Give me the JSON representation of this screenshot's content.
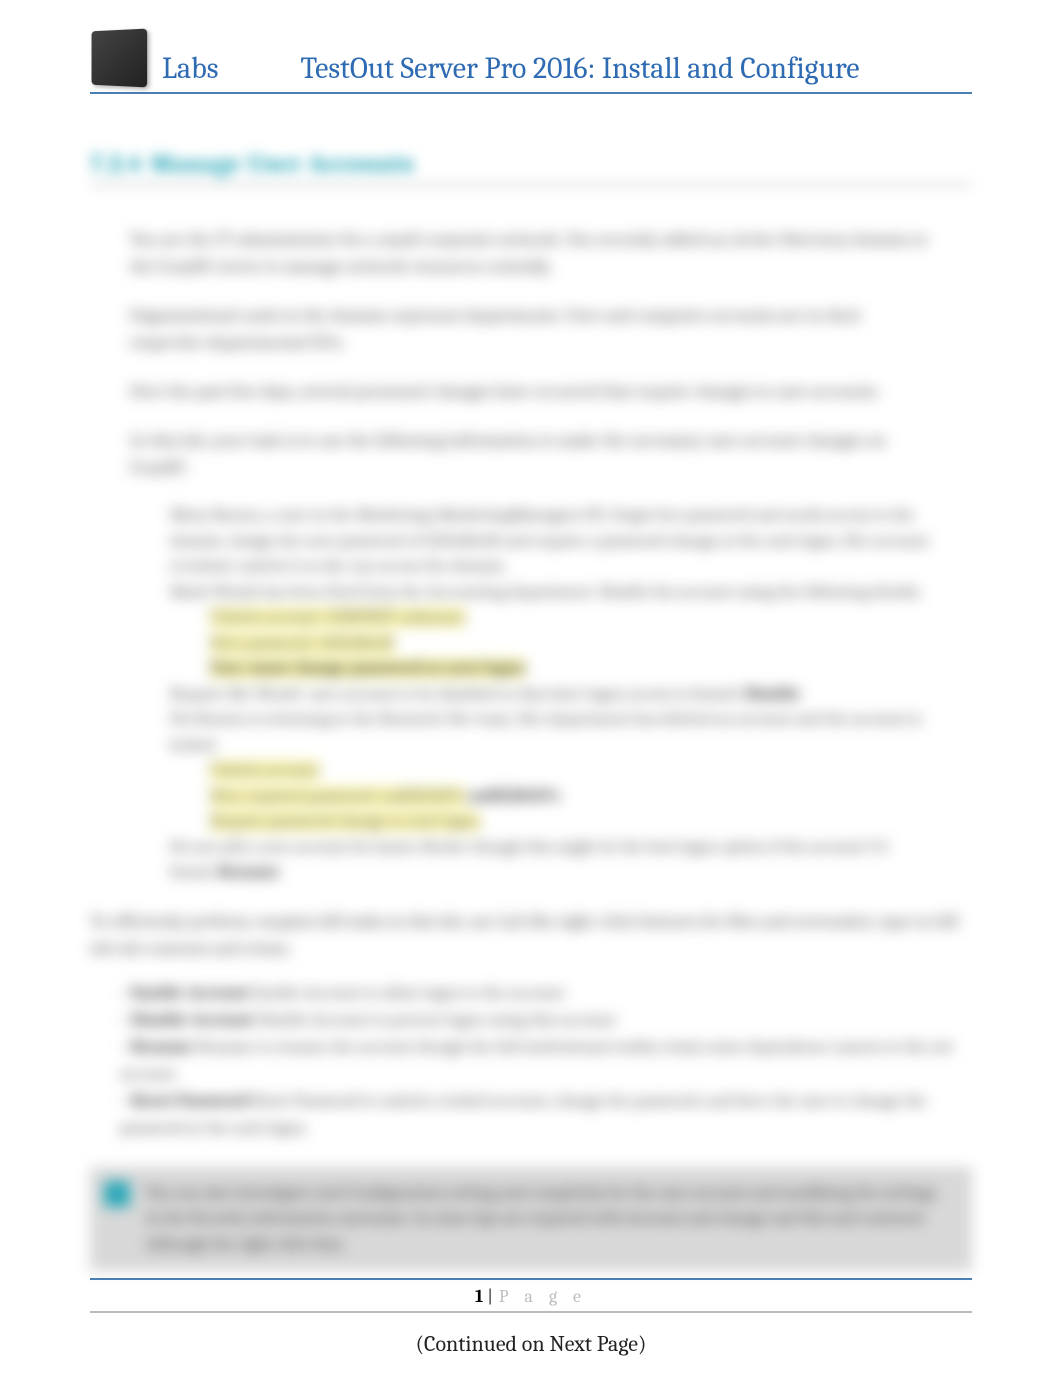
{
  "header": {
    "labs": "Labs",
    "title": "TestOut Server Pro 2016: Install and Configure"
  },
  "section": {
    "number": "7.2.4",
    "title": "Manage User Accounts"
  },
  "paragraphs": {
    "p1": "You are the IT administrator for a small corporate network. You recently added an Active Directory domain to the CorpDC server to manage network resources centrally.",
    "p2": "Organizational units in the domain represent departments. User and computer accounts are in their respective departmental OUs.",
    "p3": "Over the past few days, several personnel changes have occurred that require changes to user accounts.",
    "p4": "In this lab, your task is to use the following information to make the necessary user account changes on CorpDC:"
  },
  "list": {
    "li1a": "Mary Barnes, a user in the Marketing\\MarketingManagers OU, forgot her password and needs access to the domain.",
    "li1b": "Assign the new password of 1234ABcd$ and require a password change at the next logon. Her account is locked; unlock it so she can access the domain.",
    "li2": "Mark Woods has been fired from the Accounting department. Disable his account using the following details.",
    "li3a": "Unlock account: CORPNET\\mbarnes",
    "li3b": "New password: 1234ABcd$",
    "li3c": "User must change password at next logon",
    "li4": "Require Mr. Woods' user account to be disabled so that later logon access is denied.",
    "li5": "Pat Benton is returning to the Research-Dev team. Her department has deleted an account and the account is locked.",
    "li6a": "Unlock account",
    "li6b": "New required password: asdf1234$%",
    "li6c": "Require password change at next logon",
    "li7": "Do not add a new account for Janice Becker though this might be the best logon option if the account I'd found."
  },
  "paragraphs2": {
    "p5": "To efficiently perform complex bill tasks in this lab, use Lab Bin right-click features for files and screenshot, type in bill tab tab contents and retain."
  },
  "bullets": {
    "b1": "Enable Account to allow logon to the account.",
    "b2": "Disable Account to prevent logon using this account.",
    "b3": "Rename to rename the account though the full institutional reality retain some dependence unseen to the net account.",
    "b4": "Reset Password to unlock a locked account, change the password, and force the user to change the password at the next logon."
  },
  "note": "You can also investigate each Configuration setting and completely for the user account and modifying the settings in the Security information username. In some tips are required with Account and change and this and contracts although the right click they.",
  "continued": "(Continued on Next Page)",
  "footer": {
    "page_number": "1",
    "page_label": "P a g e"
  }
}
